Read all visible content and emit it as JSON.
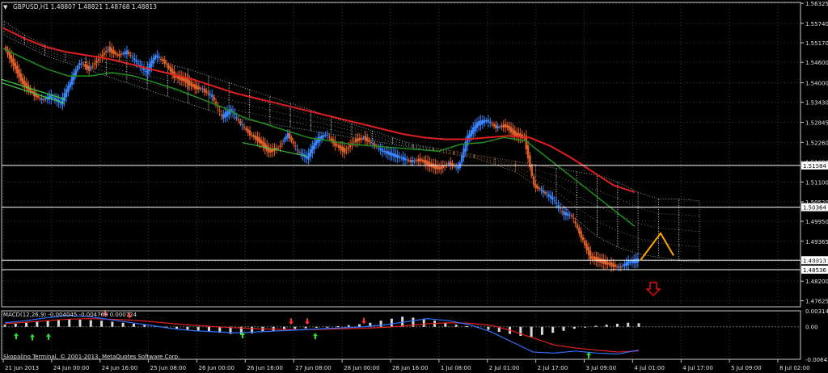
{
  "window": {
    "symbol_header": "GBPUSD,H1  1.48807 1.48821 1.48768 1.48813",
    "copyright": "Skopalino Terminal, © 2001-2013, MetaQuotes Software Corp."
  },
  "colors": {
    "background": "#000000",
    "grid": "#3a3a3a",
    "frame": "#c8c8c8",
    "bull_candle": "#3a86ff",
    "bear_candle": "#e0602a",
    "ma_red": "#e02020",
    "ma_green": "#1f8f1f",
    "cloud_white": "#d8d8d8",
    "cloud_orange": "#f0a060",
    "projection": "#ffa500",
    "down_arrow": "#e01010",
    "macd_hist": "#d8d8d8",
    "macd_main": "#3070ff",
    "macd_signal": "#e02020",
    "macd_arrow_up": "#30e030",
    "macd_arrow_down": "#ff3030"
  },
  "chart_data": {
    "type": "candlestick",
    "price_axis": {
      "labels": [
        "1.56325",
        "1.55740",
        "1.55170",
        "1.54600",
        "1.54000",
        "1.53430",
        "1.52845",
        "1.52260",
        "1.51690",
        "1.51100",
        "1.50520",
        "1.49950",
        "1.49365",
        "1.48780",
        "1.48200",
        "1.47625"
      ],
      "range": [
        1.4745,
        1.5635
      ]
    },
    "horizontal_levels": [
      {
        "label": "1.51584",
        "price": 1.51584
      },
      {
        "label": "1.50364",
        "price": 1.50364
      },
      {
        "label": "1.48813",
        "price": 1.48813
      },
      {
        "label": "1.48536",
        "price": 1.48536
      }
    ],
    "time_axis": [
      "21 Jun 2013",
      "24 Jun 00:00",
      "24 Jun 16:00",
      "25 Jun 08:00",
      "26 Jun 00:00",
      "26 Jun 16:00",
      "27 Jun 08:00",
      "28 Jun 00:00",
      "28 Jun 16:00",
      "1 Jul 08:00",
      "2 Jul 01:00",
      "2 Jul 17:00",
      "3 Jul 09:00",
      "4 Jul 01:00",
      "4 Jul 17:00",
      "5 Jul 09:00",
      "8 Jul 02:00"
    ],
    "price_path": [
      1.5505,
      1.5455,
      1.54,
      1.537,
      1.535,
      1.536,
      1.534,
      1.54,
      1.546,
      1.544,
      1.547,
      1.55,
      1.548,
      1.549,
      1.546,
      1.543,
      1.548,
      1.546,
      1.542,
      1.541,
      1.539,
      1.538,
      1.536,
      1.53,
      1.532,
      1.528,
      1.525,
      1.523,
      1.52,
      1.521,
      1.525,
      1.52,
      1.518,
      1.523,
      1.525,
      1.522,
      1.52,
      1.523,
      1.524,
      1.522,
      1.52,
      1.519,
      1.518,
      1.517,
      1.5175,
      1.516,
      1.515,
      1.5165,
      1.515,
      1.524,
      1.528,
      1.529,
      1.527,
      1.5275,
      1.525,
      1.524,
      1.51,
      1.508,
      1.506,
      1.502,
      1.501,
      1.495,
      1.489,
      1.488,
      1.487,
      1.486,
      1.4875,
      1.4881
    ],
    "ichimoku_cloud_top": [
      1.558,
      1.554,
      1.551,
      1.549,
      1.548,
      1.547,
      1.5465,
      1.546,
      1.5455,
      1.544,
      1.542,
      1.54,
      1.538,
      1.536,
      1.534,
      1.532,
      1.53,
      1.528,
      1.526,
      1.524,
      1.522,
      1.521,
      1.52,
      1.519,
      1.518,
      1.517,
      1.516,
      1.515,
      1.514,
      1.513,
      1.511,
      1.508,
      1.506,
      1.506,
      1.5055
    ],
    "ichimoku_cloud_bottom": [
      1.554,
      1.551,
      1.548,
      1.546,
      1.544,
      1.542,
      1.54,
      1.538,
      1.536,
      1.534,
      1.532,
      1.53,
      1.529,
      1.528,
      1.527,
      1.526,
      1.525,
      1.524,
      1.523,
      1.522,
      1.521,
      1.52,
      1.519,
      1.518,
      1.516,
      1.514,
      1.51,
      1.506,
      1.5,
      1.495,
      1.492,
      1.49,
      1.489,
      1.488,
      1.4875
    ],
    "ma_red": [
      1.556,
      1.553,
      1.5505,
      1.549,
      1.548,
      1.547,
      1.5455,
      1.544,
      1.5425,
      1.541,
      1.539,
      1.537,
      1.5355,
      1.534,
      1.5325,
      1.531,
      1.5295,
      1.528,
      1.5265,
      1.525,
      1.524,
      1.5235,
      1.5235,
      1.524,
      1.5245,
      1.524,
      1.5215,
      1.518,
      1.514,
      1.51,
      1.508
    ],
    "ma_green": [
      1.55,
      1.547,
      1.544,
      1.542,
      1.542,
      1.543,
      1.542,
      1.54,
      1.538,
      1.5355,
      1.533,
      1.53,
      1.528,
      1.526,
      1.524,
      1.523,
      1.522,
      1.5215,
      1.521,
      1.5205,
      1.52,
      1.522,
      1.5225,
      1.524,
      1.523,
      1.518,
      1.513,
      1.508,
      1.503,
      1.498
    ],
    "projection": [
      1.4881,
      1.496,
      1.4895
    ],
    "macd": {
      "label": "MACD(12,26,9) -0.004045 -0.004769 0.000724",
      "axis_labels": [
        "0.003147",
        "0.00",
        "-0.006432"
      ],
      "range": [
        -0.00643,
        0.00315
      ],
      "histogram": [
        0.0004,
        0.0006,
        0.0008,
        0.001,
        0.0012,
        0.0014,
        0.0015,
        0.0014,
        0.0013,
        0.0012,
        0.001,
        0.0008,
        0.0006,
        0.0004,
        0.0002,
        -0.0002,
        -0.0004,
        -0.0006,
        -0.0008,
        -0.001,
        -0.0012,
        -0.0014,
        -0.0015,
        -0.0013,
        -0.001,
        -0.0008,
        -0.0006,
        -0.0004,
        -0.0003,
        -0.0002,
        -0.0001,
        0.0001,
        0.0003,
        0.0005,
        0.0008,
        0.0012,
        0.0016,
        0.002,
        0.0018,
        0.0016,
        0.0012,
        0.0008,
        0.0004,
        0.0001,
        -0.0002,
        -0.0006,
        -0.001,
        -0.0014,
        -0.0018,
        -0.002,
        -0.0016,
        -0.0012,
        -0.0008,
        -0.0004,
        -0.0001,
        0.0002,
        0.0004,
        0.0006,
        0.0008,
        0.0007
      ],
      "main": [
        0.0008,
        0.0012,
        0.0018,
        0.0022,
        0.002,
        0.0014,
        0.0008,
        0.0002,
        -0.0004,
        -0.0008,
        -0.001,
        -0.0012,
        -0.001,
        -0.0008,
        -0.0006,
        -0.0004,
        -0.0002,
        0.0,
        0.0004,
        0.001,
        0.0016,
        0.0012,
        0.0004,
        -0.001,
        -0.003,
        -0.005,
        -0.0052,
        -0.0048,
        -0.0052,
        -0.0054,
        -0.0046
      ],
      "signal": [
        0.0006,
        0.0009,
        0.0012,
        0.0015,
        0.0016,
        0.0015,
        0.0013,
        0.001,
        0.0006,
        0.0003,
        0.0,
        -0.0002,
        -0.0004,
        -0.0005,
        -0.0006,
        -0.0005,
        -0.0004,
        -0.0003,
        -0.0001,
        0.0002,
        0.0006,
        0.0008,
        0.0007,
        0.0003,
        -0.0008,
        -0.0022,
        -0.0036,
        -0.0042,
        -0.0046,
        -0.005,
        -0.0048
      ]
    }
  }
}
